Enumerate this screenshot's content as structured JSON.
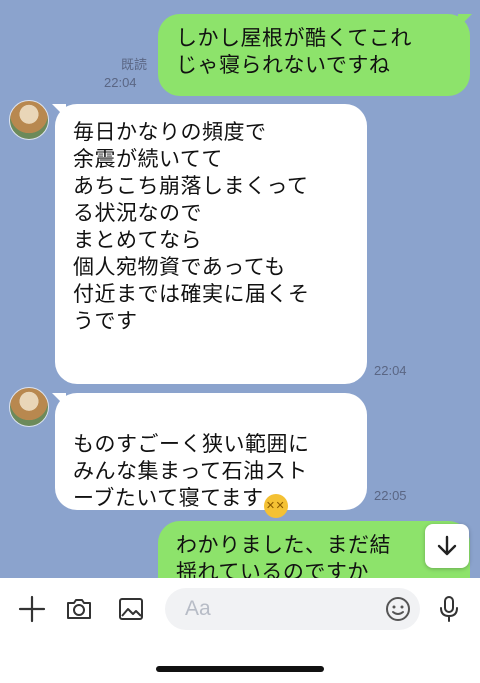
{
  "messages": [
    {
      "type": "sent",
      "text": "しかし屋根が酷くてこれ\nじゃ寝られないですね",
      "read": "既読",
      "time": "22:04"
    },
    {
      "type": "received",
      "text": "毎日かなりの頻度で\n余震が続いてて\nあちこち崩落しまくって\nる状況なので\nまとめてなら\n個人宛物資であっても\n付近までは確実に届くそ\nうです",
      "time": "22:04"
    },
    {
      "type": "received",
      "text": "ものすごーく狭い範囲に\nみんな集まって石油スト\nーブたいて寝てます",
      "emoji": "confounded-face",
      "time": "22:05"
    },
    {
      "type": "sent",
      "text": "わかりました、まだ結\n揺れているのですか"
    }
  ],
  "input": {
    "placeholder": "Aa"
  },
  "icons": {
    "add": "plus-icon",
    "camera": "camera-icon",
    "image": "image-icon",
    "emoji": "smiley-icon",
    "mic": "microphone-icon",
    "scroll": "arrow-down-icon"
  },
  "colors": {
    "chat_bg": "#8ba3cd",
    "sent_bubble": "#8de36b",
    "received_bubble": "#ffffff"
  }
}
